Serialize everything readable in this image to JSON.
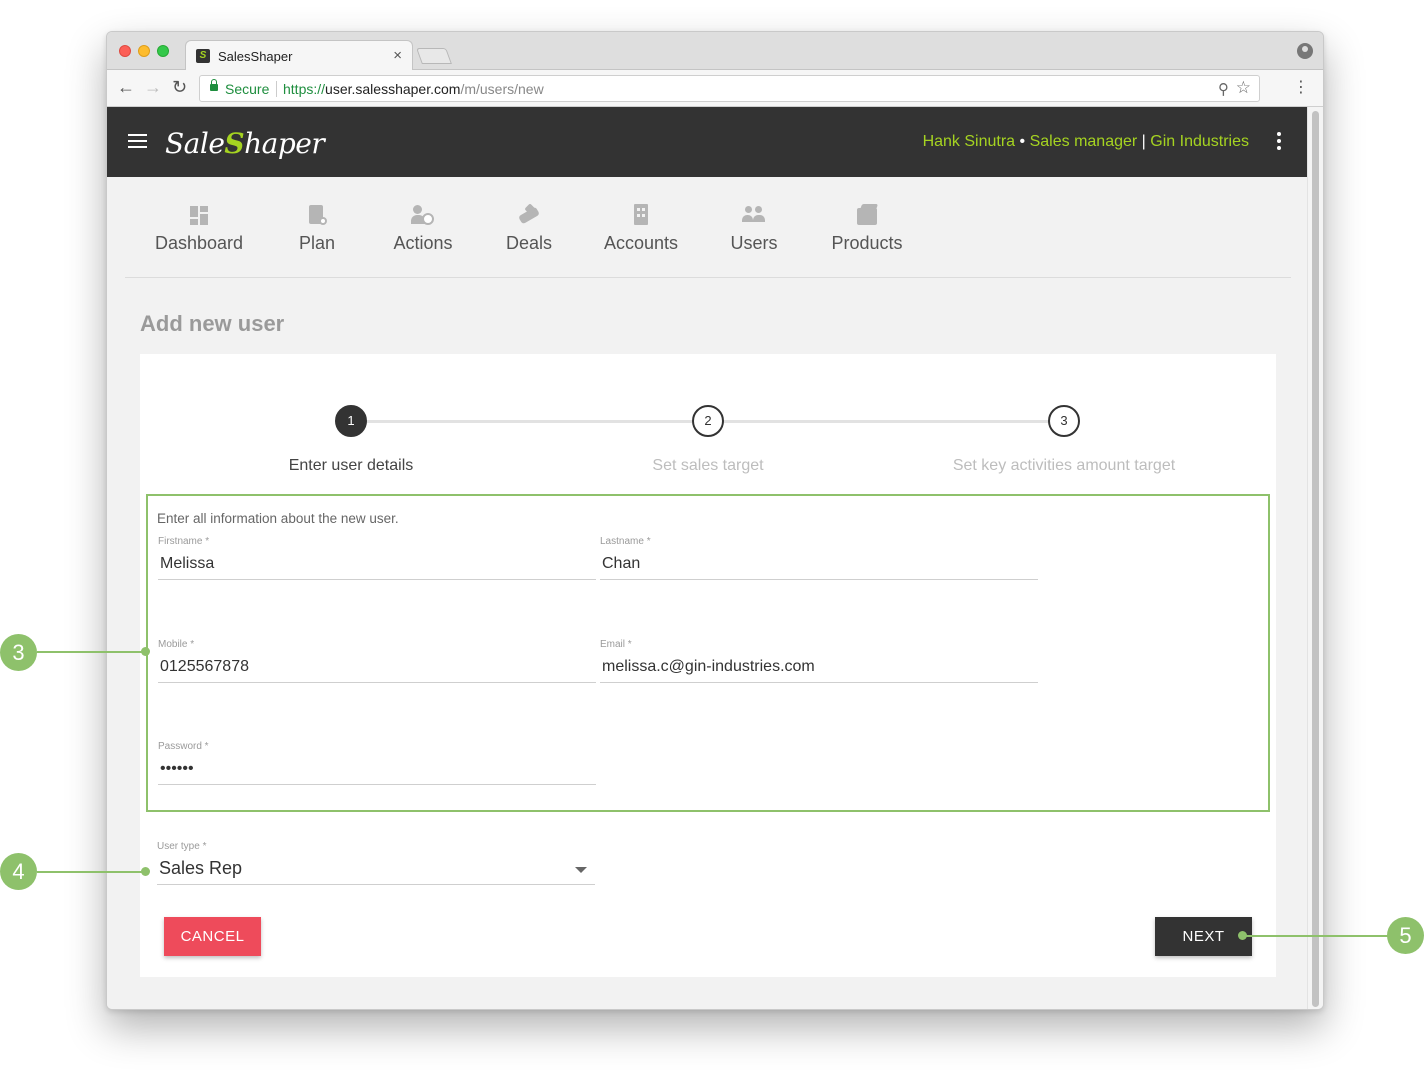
{
  "browser": {
    "tab_title": "SalesShaper",
    "tab_close": "×",
    "secure_label": "Secure",
    "url_scheme": "https://",
    "url_host": "user.salesshaper.com",
    "url_path": "/m/users/new"
  },
  "app": {
    "brand_left": "Sale",
    "brand_mark": "S",
    "brand_right": "haper",
    "user_name": "Hank Sinutra",
    "user_role": "Sales manager",
    "user_company": "Gin Industries",
    "dot_sep": "•",
    "bar_sep": "|"
  },
  "nav": {
    "items": [
      {
        "label": "Dashboard",
        "icon": "dashboard-icon"
      },
      {
        "label": "Plan",
        "icon": "plan-icon"
      },
      {
        "label": "Actions",
        "icon": "actions-icon"
      },
      {
        "label": "Deals",
        "icon": "deals-icon"
      },
      {
        "label": "Accounts",
        "icon": "accounts-icon"
      },
      {
        "label": "Users",
        "icon": "users-icon"
      },
      {
        "label": "Products",
        "icon": "products-icon"
      }
    ]
  },
  "page": {
    "title": "Add new user"
  },
  "stepper": {
    "steps": [
      {
        "number": "1",
        "label": "Enter user details",
        "active": true
      },
      {
        "number": "2",
        "label": "Set sales target",
        "active": false
      },
      {
        "number": "3",
        "label": "Set key activities amount target",
        "active": false
      }
    ]
  },
  "form": {
    "intro": "Enter all information about the new user.",
    "firstname": {
      "label": "Firstname *",
      "value": "Melissa"
    },
    "lastname": {
      "label": "Lastname *",
      "value": "Chan"
    },
    "mobile": {
      "label": "Mobile *",
      "value": "0125567878"
    },
    "email": {
      "label": "Email *",
      "value": "melissa.c@gin-industries.com"
    },
    "password": {
      "label": "Password *",
      "value": "••••••"
    },
    "user_type": {
      "label": "User type *",
      "value": "Sales Rep"
    }
  },
  "actions": {
    "cancel_label": "CANCEL",
    "next_label": "NEXT"
  },
  "callouts": {
    "c3": "3",
    "c4": "4",
    "c5": "5"
  },
  "colors": {
    "accent": "#a5d321",
    "callout": "#8ec16b",
    "appbar": "#333333",
    "cancel": "#ee4b5b"
  }
}
